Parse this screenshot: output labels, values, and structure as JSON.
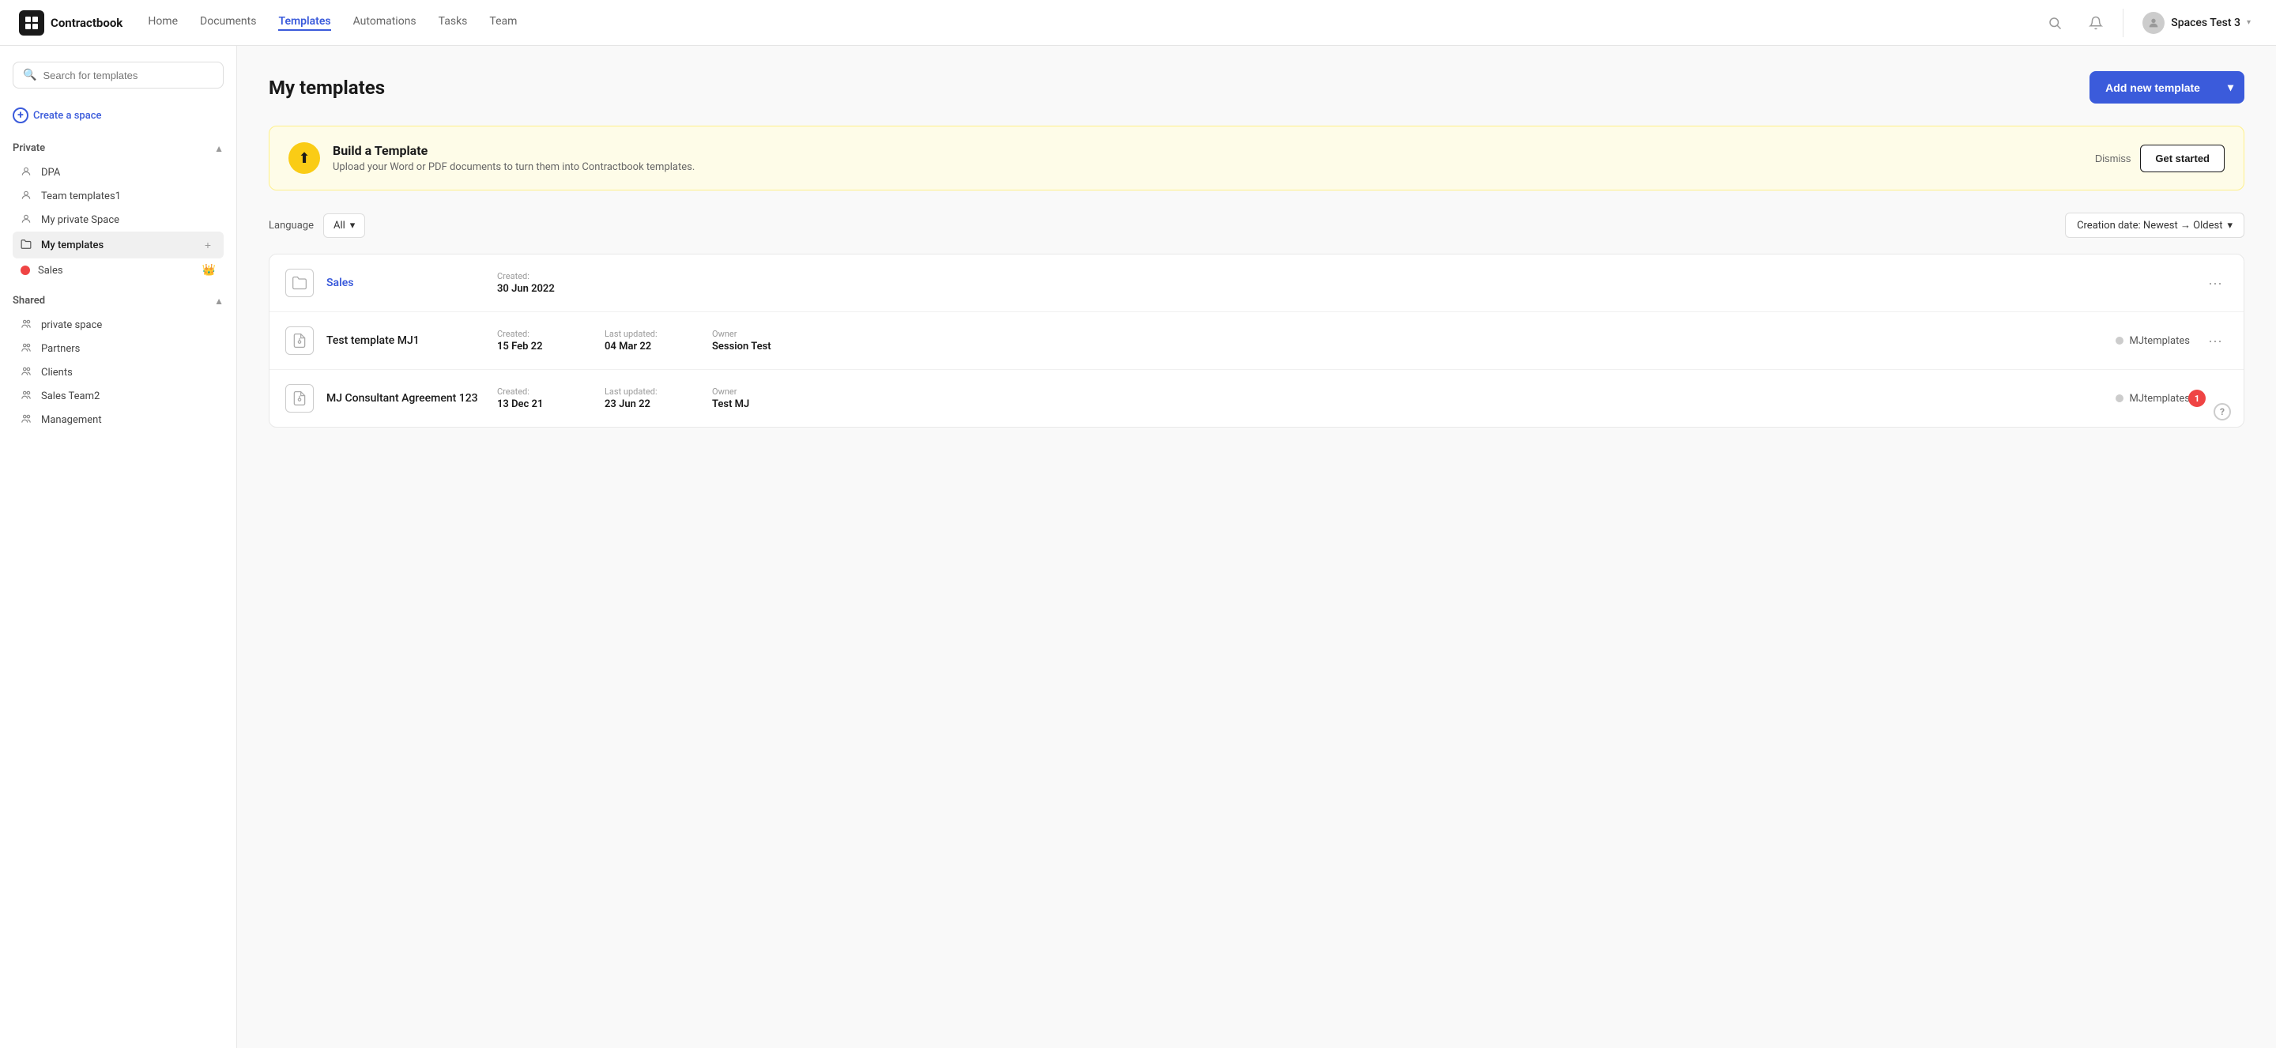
{
  "app": {
    "logo_text": "Contractbook"
  },
  "nav": {
    "links": [
      {
        "label": "Home",
        "active": false
      },
      {
        "label": "Documents",
        "active": false
      },
      {
        "label": "Templates",
        "active": true
      },
      {
        "label": "Automations",
        "active": false
      },
      {
        "label": "Tasks",
        "active": false
      },
      {
        "label": "Team",
        "active": false
      }
    ],
    "user_name": "Spaces Test 3"
  },
  "sidebar": {
    "search_placeholder": "Search for templates",
    "create_space_label": "Create a space",
    "sections": {
      "private": {
        "title": "Private",
        "items": [
          {
            "label": "DPA",
            "icon": "user"
          },
          {
            "label": "Team templates1",
            "icon": "user"
          },
          {
            "label": "My private Space",
            "icon": "user"
          },
          {
            "label": "My templates",
            "icon": "folder",
            "active": true
          },
          {
            "label": "Sales",
            "icon": "dot-red"
          }
        ]
      },
      "shared": {
        "title": "Shared",
        "items": [
          {
            "label": "private space",
            "icon": "users"
          },
          {
            "label": "Partners",
            "icon": "users"
          },
          {
            "label": "Clients",
            "icon": "users"
          },
          {
            "label": "Sales Team2",
            "icon": "users"
          },
          {
            "label": "Management",
            "icon": "users"
          }
        ]
      }
    }
  },
  "main": {
    "page_title": "My templates",
    "add_btn_label": "Add new template",
    "banner": {
      "title": "Build a Template",
      "subtitle": "Upload your Word or PDF documents to turn them into Contractbook templates.",
      "dismiss_label": "Dismiss",
      "get_started_label": "Get started"
    },
    "filters": {
      "language_label": "Language",
      "language_value": "All",
      "sort_label": "Creation date: Newest → Oldest"
    },
    "templates": [
      {
        "name": "Sales",
        "is_link": true,
        "icon": "folder",
        "created_label": "Created:",
        "created_date": "30 Jun 2022",
        "last_updated_label": null,
        "last_updated_date": null,
        "owner_label": null,
        "owner_name": null,
        "space_dot_color": null,
        "space_name": null,
        "has_badge": false,
        "badge_count": null,
        "has_help": false
      },
      {
        "name": "Test template MJ1",
        "is_link": false,
        "icon": "doc",
        "created_label": "Created:",
        "created_date": "15 Feb 22",
        "last_updated_label": "Last updated:",
        "last_updated_date": "04 Mar 22",
        "owner_label": "Owner",
        "owner_name": "Session Test",
        "space_dot_color": "#bbb",
        "space_name": "MJtemplates",
        "has_badge": false,
        "badge_count": null,
        "has_help": false
      },
      {
        "name": "MJ Consultant Agreement 123",
        "is_link": false,
        "icon": "doc",
        "created_label": "Created:",
        "created_date": "13 Dec 21",
        "last_updated_label": "Last updated:",
        "last_updated_date": "23 Jun 22",
        "owner_label": "Owner",
        "owner_name": "Test MJ",
        "space_dot_color": "#bbb",
        "space_name": "MJtemplates",
        "has_badge": true,
        "badge_count": "1",
        "has_help": true
      }
    ]
  }
}
